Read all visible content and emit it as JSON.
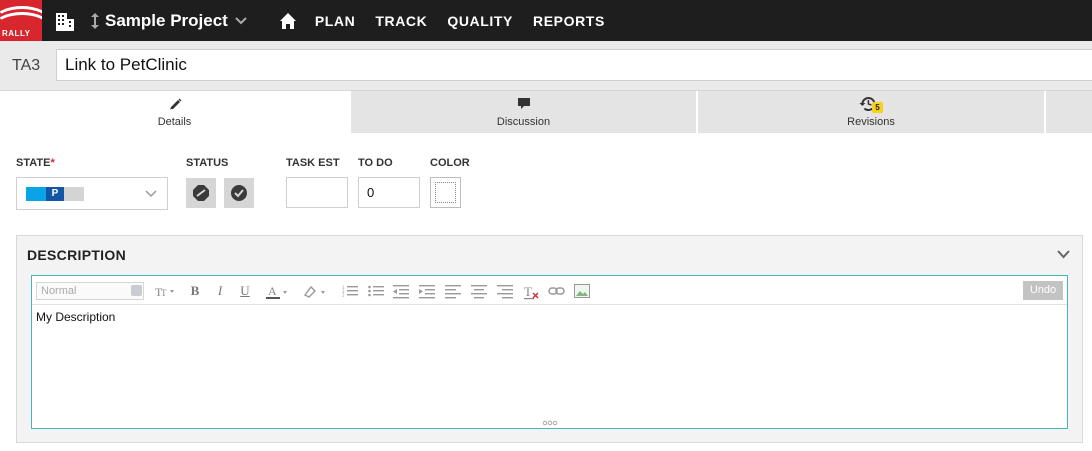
{
  "app": {
    "logo_text": "RALLY",
    "project_name": "Sample Project",
    "nav": [
      "PLAN",
      "TRACK",
      "QUALITY",
      "REPORTS"
    ]
  },
  "artifact": {
    "id": "TA3",
    "title": "Link to PetClinic"
  },
  "tabs": [
    {
      "label": "Details",
      "icon": "pencil-icon",
      "active": true
    },
    {
      "label": "Discussion",
      "icon": "speech-bubble-icon",
      "active": false
    },
    {
      "label": "Revisions",
      "icon": "history-icon",
      "badge": "5",
      "active": false
    }
  ],
  "fields": {
    "state_label": "STATE",
    "state_required_mark": "*",
    "state_chips": [
      "",
      "P",
      ""
    ],
    "status_label": "STATUS",
    "task_est_label": "TASK EST",
    "task_est_value": "",
    "todo_label": "TO DO",
    "todo_value": "0",
    "color_label": "COLOR"
  },
  "description": {
    "title": "DESCRIPTION",
    "format_placeholder": "Normal",
    "undo_label": "Undo",
    "content": "My Description"
  },
  "colors": {
    "topbar": "#1e1e1e",
    "brand_red": "#d8262f",
    "state_defined": "#0aa3e6",
    "state_in_progress": "#1256a5",
    "editor_border": "#47b6b9",
    "badge": "#f7d21a"
  }
}
